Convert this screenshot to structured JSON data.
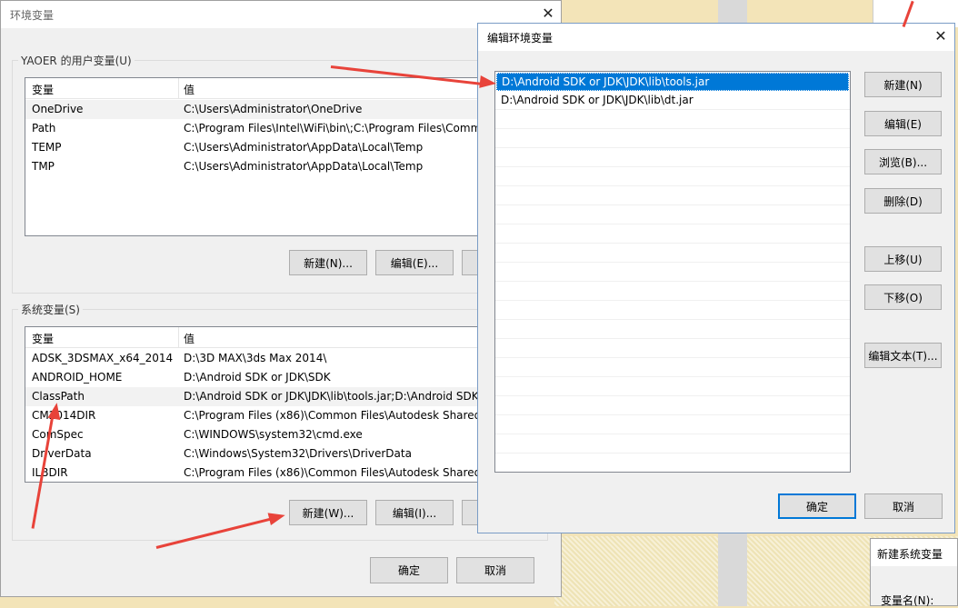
{
  "env_dialog": {
    "title": "环境变量",
    "user_group_label": "YAOER 的用户变量(U)",
    "system_group_label": "系统变量(S)",
    "col_variable": "变量",
    "col_value": "值",
    "user_rows": [
      {
        "name": "OneDrive",
        "value": "C:\\Users\\Administrator\\OneDrive"
      },
      {
        "name": "Path",
        "value": "C:\\Program Files\\Intel\\WiFi\\bin\\;C:\\Program Files\\Comm"
      },
      {
        "name": "TEMP",
        "value": "C:\\Users\\Administrator\\AppData\\Local\\Temp"
      },
      {
        "name": "TMP",
        "value": "C:\\Users\\Administrator\\AppData\\Local\\Temp"
      }
    ],
    "system_rows": [
      {
        "name": "ADSK_3DSMAX_x64_2014",
        "value": "D:\\3D MAX\\3ds Max 2014\\"
      },
      {
        "name": "ANDROID_HOME",
        "value": "D:\\Android SDK or JDK\\SDK"
      },
      {
        "name": "ClassPath",
        "value": "D:\\Android SDK or JDK\\JDK\\lib\\tools.jar;D:\\Android SDK"
      },
      {
        "name": "CM2014DIR",
        "value": "C:\\Program Files (x86)\\Common Files\\Autodesk Shared\\"
      },
      {
        "name": "ComSpec",
        "value": "C:\\WINDOWS\\system32\\cmd.exe"
      },
      {
        "name": "DriverData",
        "value": "C:\\Windows\\System32\\Drivers\\DriverData"
      },
      {
        "name": "ILBDIR",
        "value": "C:\\Program Files (x86)\\Common Files\\Autodesk Shared\\"
      }
    ],
    "user_new": "新建(N)...",
    "user_edit": "编辑(E)...",
    "sys_new": "新建(W)...",
    "sys_edit": "编辑(I)...",
    "ok": "确定",
    "cancel": "取消"
  },
  "edit_dialog": {
    "title": "编辑环境变量",
    "entries": [
      "D:\\Android SDK or JDK\\JDK\\lib\\tools.jar",
      "D:\\Android SDK or JDK\\JDK\\lib\\dt.jar"
    ],
    "btn_new": "新建(N)",
    "btn_edit": "编辑(E)",
    "btn_browse": "浏览(B)...",
    "btn_delete": "删除(D)",
    "btn_up": "上移(U)",
    "btn_down": "下移(O)",
    "btn_edit_text": "编辑文本(T)...",
    "ok": "确定",
    "cancel": "取消"
  },
  "new_sys_dialog": {
    "title": "新建系统变量",
    "var_name_label": "变量名(N):"
  },
  "colors": {
    "selection": "#0078d7",
    "arrow": "#e8433a"
  }
}
